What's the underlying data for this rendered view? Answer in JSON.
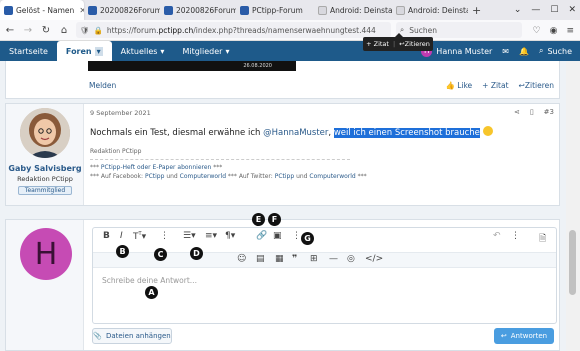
{
  "browser": {
    "tabs": [
      {
        "label": "Gelöst - Namen"
      },
      {
        "label": "20200826Forum("
      },
      {
        "label": "20200826Forum("
      },
      {
        "label": "PCtipp-Forum"
      },
      {
        "label": "Android: Deinstal"
      },
      {
        "label": "Android: Deinstal"
      }
    ],
    "url_prefix": "https://forum.",
    "url_host": "pctipp.ch",
    "url_path": "/index.php?threads/namenserwaehnungtest.444",
    "search_placeholder": "Suchen"
  },
  "forum_nav": {
    "items": [
      "Startseite",
      "Foren",
      "Aktuelles",
      "Mitglieder"
    ],
    "user": "Hanna Muster",
    "user_initial": "H",
    "search": "Suche"
  },
  "post1": {
    "video_date": "26.08.2020",
    "melden": "Melden",
    "like": "Like",
    "zitat": "+ Zitat",
    "zitieren": "Zitieren"
  },
  "post2": {
    "date": "9 September 2021",
    "number": "#3",
    "author": "Gaby Salvisberg",
    "author_title": "Redaktion PCtipp",
    "badge": "Teammitglied",
    "text_before": "Nochmals ein Test, diesmal erwähne ich ",
    "mention": "@HannaMuster",
    "text_sep": ", ",
    "selected": "weil ich einen Screenshot brauche",
    "tooltip_zitat": "+ Zitat",
    "tooltip_zitieren": "Zitieren",
    "sig_line1": "Redaktion PCtipp",
    "sig_line2_a": "*** ",
    "sig_line2_link": "PCtipp-Heft oder E-Paper abonnieren",
    "sig_line2_b": " ***",
    "sig_line3_a": "*** Auf Facebook: ",
    "sig_line3_link1": "PCtipp",
    "sig_line3_b": " und ",
    "sig_line3_link2": "Computerworld",
    "sig_line3_c": " *** Auf Twitter: ",
    "sig_line3_link3": "PCtipp",
    "sig_line3_d": " und ",
    "sig_line3_link4": "Computerworld",
    "sig_line3_e": " ***"
  },
  "reply": {
    "avatar_initial": "H",
    "placeholder": "Schreibe deine Antwort...",
    "attach": "Dateien anhängen",
    "send": "Antworten"
  },
  "markers": {
    "a": "A",
    "b": "B",
    "c": "C",
    "d": "D",
    "e": "E",
    "f": "F",
    "g": "G"
  }
}
